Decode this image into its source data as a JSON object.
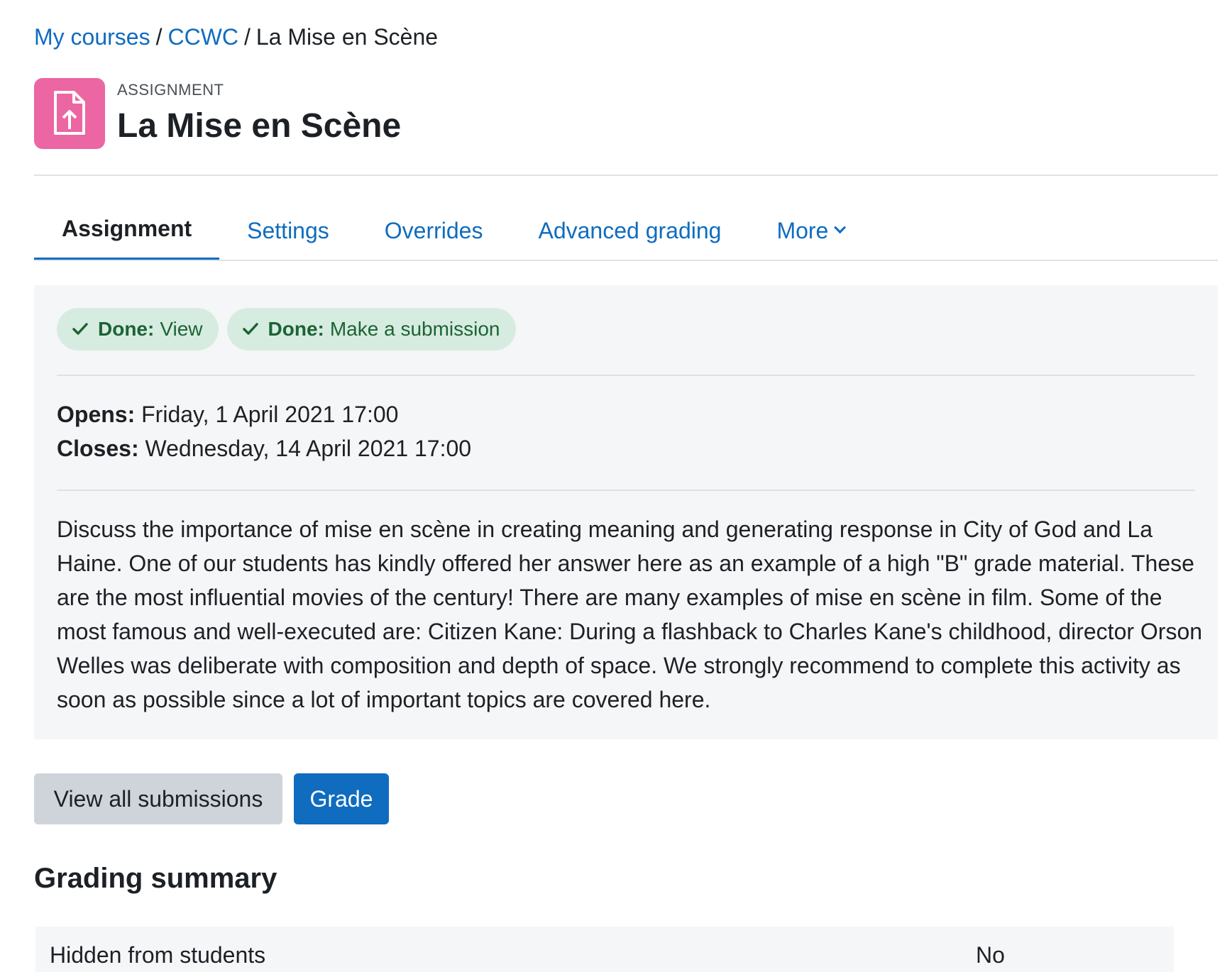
{
  "breadcrumb": {
    "items": [
      {
        "label": "My courses",
        "link": true
      },
      {
        "label": "CCWC",
        "link": true
      },
      {
        "label": "La Mise en Scène",
        "link": false
      }
    ],
    "separator": "/"
  },
  "header": {
    "activity_type": "ASSIGNMENT",
    "title": "La Mise en Scène",
    "icon": "file-upload-icon",
    "icon_color": "#eb66a2"
  },
  "tabs": [
    {
      "label": "Assignment",
      "active": true
    },
    {
      "label": "Settings",
      "active": false
    },
    {
      "label": "Overrides",
      "active": false
    },
    {
      "label": "Advanced grading",
      "active": false
    },
    {
      "label": "More",
      "active": false
    }
  ],
  "completion": {
    "badges": [
      {
        "status": "Done:",
        "label": "View"
      },
      {
        "status": "Done:",
        "label": "Make a submission"
      }
    ],
    "color": "#1c6335",
    "background": "#d7ece0"
  },
  "dates": {
    "opens_label": "Opens:",
    "opens_value": "Friday, 1 April 2021 17:00",
    "closes_label": "Closes:",
    "closes_value": "Wednesday, 14 April 2021 17:00"
  },
  "description": "Discuss the importance of  mise en scène in creating meaning and generating response in City of God and La Haine. One of our students has kindly offered her answer here as an example of a high \"B\" grade material. These are the most influential movies of the century! There are many examples of mise en scène in film. Some of the most famous and well-executed are: Citizen Kane: During a flashback to Charles Kane's childhood, director Orson Welles was deliberate with composition and depth of space. We strongly recommend to complete this activity as soon as possible since a lot of important topics are covered here.",
  "actions": {
    "view_all_label": "View all submissions",
    "grade_label": "Grade"
  },
  "grading_summary": {
    "title": "Grading summary",
    "rows": [
      {
        "label": "Hidden from students",
        "value": "No"
      }
    ]
  },
  "colors": {
    "link": "#0f6cbf",
    "primary": "#0f6cbf",
    "panel_bg": "#f5f6f8"
  }
}
